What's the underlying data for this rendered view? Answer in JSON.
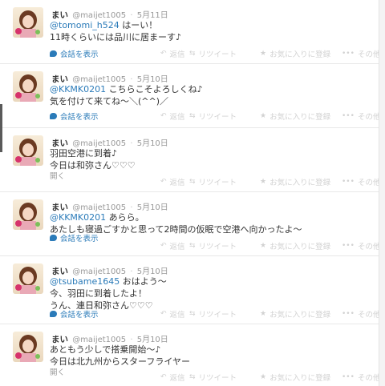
{
  "actions": {
    "reply": "返信",
    "retweet": "リツイート",
    "favorite": "お気に入りに登録",
    "more": "その他"
  },
  "icons": {
    "reply": "reply-icon",
    "retweet": "retweet-icon",
    "favorite": "star-icon",
    "more": "dots-icon",
    "conversation": "speech-bubble-icon"
  },
  "colors": {
    "link": "#2b7bb9",
    "muted": "#999999",
    "text": "#333333"
  },
  "tweets": [
    {
      "name": "まい",
      "handle": "@maijet1005",
      "date": "5月11日",
      "mention": "@tomomi_h524",
      "line1_rest": " はーい！",
      "line2": "11時くらいには品川に居まーす♪",
      "footer_type": "conversation",
      "footer": "会話を表示"
    },
    {
      "name": "まい",
      "handle": "@maijet1005",
      "date": "5月10日",
      "mention": "@KKMK0201",
      "line1_rest": " こちらこそよろしくね♪",
      "line2": "気を付けて来てね〜＼(^^)／",
      "footer_type": "conversation",
      "footer": "会話を表示"
    },
    {
      "name": "まい",
      "handle": "@maijet1005",
      "date": "5月10日",
      "mention": "",
      "line1_rest": "羽田空港に到着♪",
      "line2": "今日は和弥さん♡♡♡",
      "footer_type": "open",
      "footer": "開く"
    },
    {
      "name": "まい",
      "handle": "@maijet1005",
      "date": "5月10日",
      "mention": "@KKMK0201",
      "line1_rest": " あらら。",
      "line2": "あたしも寝過ごすかと思って2時間の仮眠で空港へ向かったよ〜",
      "footer_type": "conversation",
      "footer": "会話を表示"
    },
    {
      "name": "まい",
      "handle": "@maijet1005",
      "date": "5月10日",
      "mention": "@tsubame1645",
      "line1_rest": " おはよう〜",
      "line2": "今、羽田に到着したよ！",
      "line3": "うん、連日和弥さん♡♡♡",
      "footer_type": "conversation",
      "footer": "会話を表示"
    },
    {
      "name": "まい",
      "handle": "@maijet1005",
      "date": "5月10日",
      "mention": "",
      "line1_rest": "あともう少しで搭乗開始〜♪",
      "line2": "今日は北九州からスターフライヤー",
      "footer_type": "open",
      "footer": "開く"
    }
  ]
}
